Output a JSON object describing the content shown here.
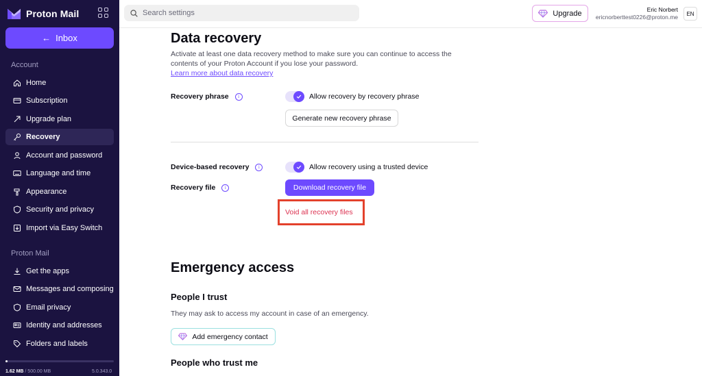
{
  "brand": {
    "name": "Proton Mail"
  },
  "sidebar": {
    "inbox_label": "Inbox",
    "account_section": "Account",
    "account_items": [
      {
        "label": "Home",
        "icon": "home-icon"
      },
      {
        "label": "Subscription",
        "icon": "card-icon"
      },
      {
        "label": "Upgrade plan",
        "icon": "arrow-up-icon"
      },
      {
        "label": "Recovery",
        "icon": "key-icon",
        "active": true
      },
      {
        "label": "Account and password",
        "icon": "user-icon"
      },
      {
        "label": "Language and time",
        "icon": "keyboard-icon"
      },
      {
        "label": "Appearance",
        "icon": "paint-icon"
      },
      {
        "label": "Security and privacy",
        "icon": "shield-icon"
      },
      {
        "label": "Import via Easy Switch",
        "icon": "import-icon"
      }
    ],
    "mail_section": "Proton Mail",
    "mail_items": [
      {
        "label": "Get the apps",
        "icon": "download-icon"
      },
      {
        "label": "Messages and composing",
        "icon": "envelope-icon"
      },
      {
        "label": "Email privacy",
        "icon": "shield-icon"
      },
      {
        "label": "Identity and addresses",
        "icon": "id-card-icon"
      },
      {
        "label": "Folders and labels",
        "icon": "tag-icon"
      }
    ],
    "storage_used": "1.62 MB",
    "storage_total": "/ 500.00 MB",
    "storage_fraction": 0.003,
    "version": "5.0.343.0"
  },
  "topbar": {
    "search_placeholder": "Search settings",
    "upgrade_label": "Upgrade",
    "user_name": "Eric Norbert",
    "user_email": "ericnorberttest0226@proton.me",
    "lang": "EN"
  },
  "data_recovery": {
    "title": "Data recovery",
    "description": "Activate at least one data recovery method to make sure you can continue to access the contents of your Proton Account if you lose your password.",
    "learn_more": "Learn more about data recovery",
    "recovery_phrase_label": "Recovery phrase",
    "recovery_phrase_toggle": "Allow recovery by recovery phrase",
    "generate_phrase_btn": "Generate new recovery phrase",
    "device_recovery_label": "Device-based recovery",
    "device_recovery_toggle": "Allow recovery using a trusted device",
    "recovery_file_label": "Recovery file",
    "download_file_btn": "Download recovery file",
    "void_files_link": "Void all recovery files"
  },
  "emergency": {
    "title": "Emergency access",
    "people_i_trust": "People I trust",
    "people_i_trust_desc": "They may ask to access my account in case of an emergency.",
    "add_contact_btn": "Add emergency contact",
    "people_who_trust_me": "People who trust me"
  },
  "colors": {
    "sidebar_bg": "#1b1340",
    "accent": "#6d4aff",
    "danger": "#dc3251",
    "highlight_box": "#e3412c"
  }
}
